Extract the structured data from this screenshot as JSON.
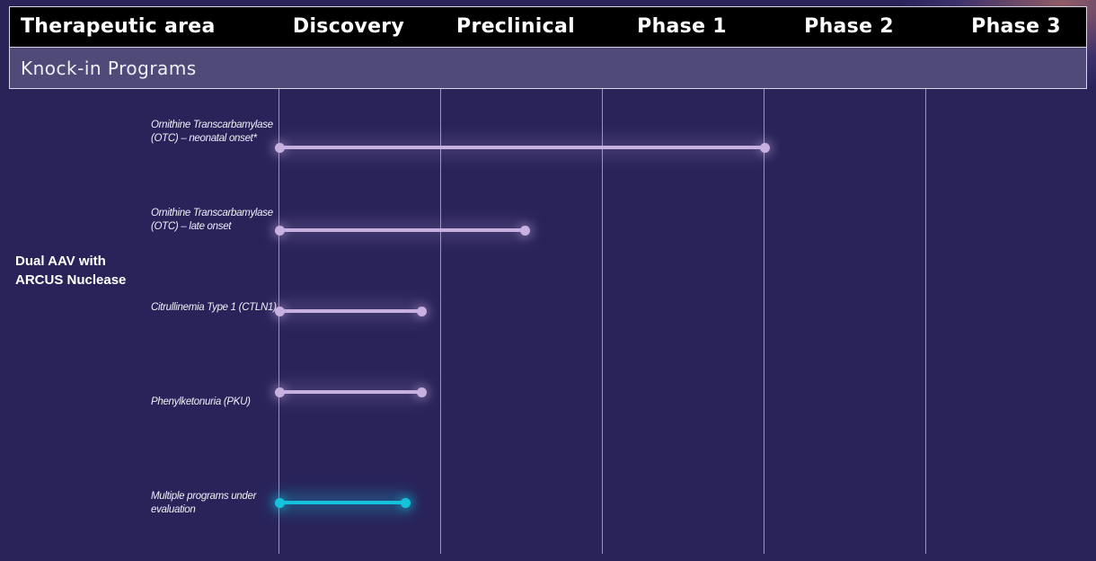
{
  "header": {
    "therapeutic_area": "Therapeutic area",
    "phases": [
      "Discovery",
      "Preclinical",
      "Phase 1",
      "Phase 2",
      "Phase 3"
    ]
  },
  "section": {
    "title": "Knock-in Programs"
  },
  "therapeutic_area_label": "Dual AAV with ARCUS Nuclease",
  "programs": [
    {
      "name": "Ornithine Transcarbamylase (OTC) – neonatal onset*",
      "progress_phase_fraction": 3.0,
      "color": "#c8b0e0"
    },
    {
      "name": "Ornithine Transcarbamylase (OTC) – late onset",
      "progress_phase_fraction": 1.52,
      "color": "#c8b0e0"
    },
    {
      "name": "Citrullinemia Type 1 (CTLN1)",
      "progress_phase_fraction": 0.88,
      "color": "#c8b0e0"
    },
    {
      "name": "Phenylketonuria (PKU)",
      "progress_phase_fraction": 0.88,
      "color": "#c8b0e0"
    },
    {
      "name": "Multiple programs under evaluation",
      "progress_phase_fraction": 0.78,
      "color": "#14c2dc"
    }
  ],
  "colors": {
    "background": "#29235a",
    "header_bg": "#000000",
    "subheader_bg": "#4f4a78",
    "bar_default": "#c8b0e0",
    "bar_highlight": "#14c2dc"
  }
}
